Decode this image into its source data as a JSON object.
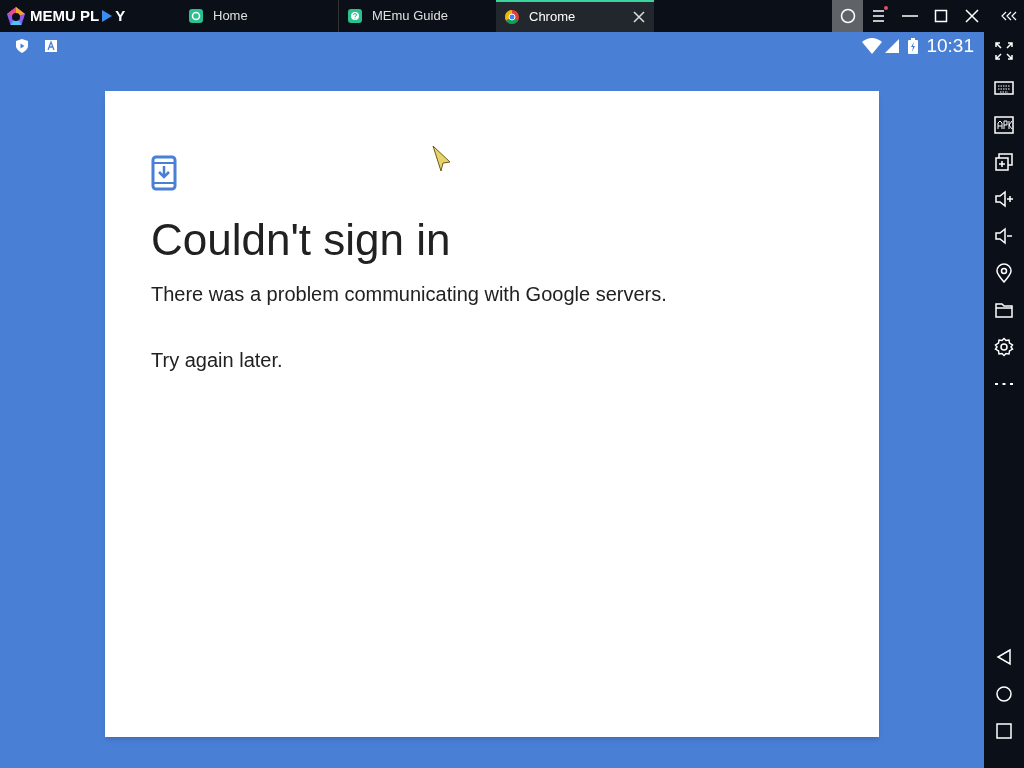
{
  "brand": {
    "text_before": "MEMU PL",
    "text_after": "Y"
  },
  "tabs": [
    {
      "label": "Home",
      "kind": "home",
      "selected": false
    },
    {
      "label": "MEmu Guide",
      "kind": "guide",
      "selected": false
    },
    {
      "label": "Chrome",
      "kind": "chrome",
      "selected": true
    }
  ],
  "window_controls": [
    {
      "kind": "record",
      "selected": true
    },
    {
      "kind": "menu",
      "badge": true,
      "selected": false
    },
    {
      "kind": "minimize",
      "selected": false
    },
    {
      "kind": "maximize",
      "selected": false
    },
    {
      "kind": "close",
      "selected": false
    },
    {
      "kind": "collapse",
      "selected": false
    }
  ],
  "status_bar": {
    "time": "10:31"
  },
  "dialog": {
    "title": "Couldn't sign in",
    "paragraphs": [
      "There was a problem communicating with Google servers.",
      "Try again later."
    ]
  },
  "sidebar_tools": [
    {
      "kind": "fullscreen"
    },
    {
      "kind": "keyboard"
    },
    {
      "kind": "apk"
    },
    {
      "kind": "multi"
    },
    {
      "kind": "volume-up"
    },
    {
      "kind": "volume-down"
    },
    {
      "kind": "location"
    },
    {
      "kind": "folder"
    },
    {
      "kind": "settings"
    },
    {
      "kind": "more"
    }
  ],
  "nav_buttons": [
    {
      "kind": "back"
    },
    {
      "kind": "home"
    },
    {
      "kind": "recents"
    }
  ]
}
